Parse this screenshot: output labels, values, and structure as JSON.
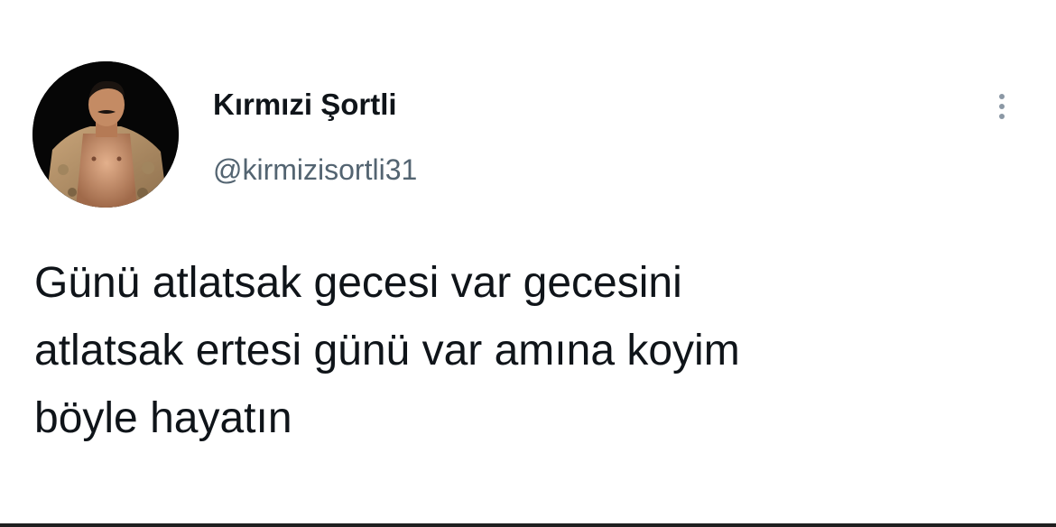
{
  "author": {
    "display_name": "Kırmızi Şortli",
    "handle": "@kirmizisortli31",
    "avatar_icon": "profile-photo"
  },
  "menu": {
    "icon": "more-vertical-icon"
  },
  "tweet": {
    "lines": [
      "Günü atlatsak gecesi var gecesini",
      "atlatsak ertesi günü var amına koyim",
      "böyle hayatın"
    ]
  },
  "colors": {
    "text_primary": "#0f1419",
    "text_secondary": "#536471",
    "background": "#ffffff"
  }
}
